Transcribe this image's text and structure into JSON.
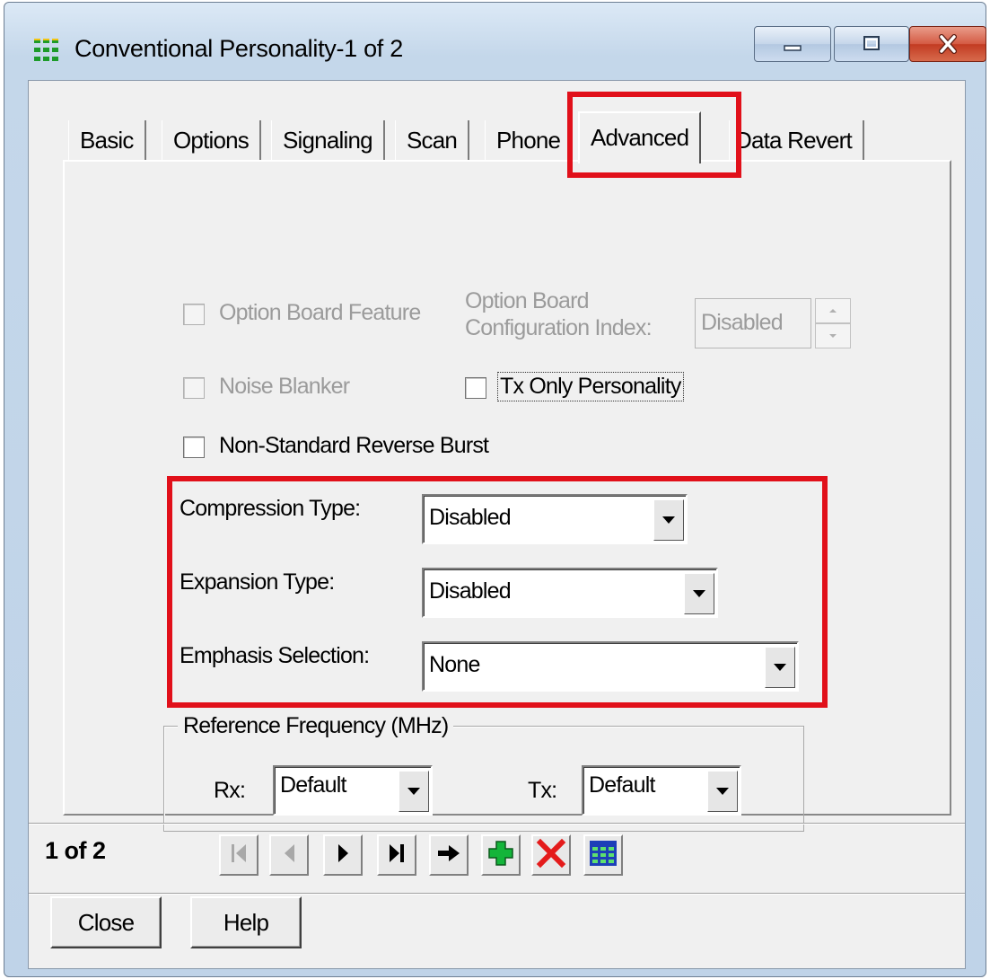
{
  "window": {
    "title": "Conventional Personality-1 of 2"
  },
  "tabs": [
    {
      "label": "Basic"
    },
    {
      "label": "Options"
    },
    {
      "label": "Signaling"
    },
    {
      "label": "Scan"
    },
    {
      "label": "Phone"
    },
    {
      "label": "Advanced",
      "selected": true
    },
    {
      "label": "Data Revert"
    }
  ],
  "advanced": {
    "option_board_feature": {
      "label": "Option Board Feature",
      "checked": false,
      "enabled": false
    },
    "option_board_config_index": {
      "label_line1": "Option Board",
      "label_line2": "Configuration Index:",
      "value": "Disabled",
      "enabled": false
    },
    "noise_blanker": {
      "label": "Noise Blanker",
      "checked": false,
      "enabled": false
    },
    "tx_only_personality": {
      "label": "Tx Only Personality",
      "checked": false
    },
    "non_standard_reverse_burst": {
      "label": "Non-Standard Reverse Burst",
      "checked": false
    },
    "compression_type": {
      "label": "Compression Type:",
      "value": "Disabled"
    },
    "expansion_type": {
      "label": "Expansion Type:",
      "value": "Disabled"
    },
    "emphasis_selection": {
      "label": "Emphasis Selection:",
      "value": "None"
    },
    "reference_frequency": {
      "legend": "Reference Frequency (MHz)",
      "rx_label": "Rx:",
      "rx_value": "Default",
      "tx_label": "Tx:",
      "tx_value": "Default"
    }
  },
  "record": {
    "position": "1 of 2"
  },
  "buttons": {
    "close": "Close",
    "help": "Help"
  },
  "colors": {
    "highlight": "#e1101a",
    "panel": "#f0f0f0",
    "add_icon": "#14b53a",
    "delete_icon": "#e41b1b"
  },
  "nav_icons": [
    "first-record-icon",
    "previous-record-icon",
    "next-record-icon",
    "last-record-icon",
    "goto-record-icon",
    "add-record-icon",
    "delete-record-icon",
    "grid-view-icon"
  ]
}
